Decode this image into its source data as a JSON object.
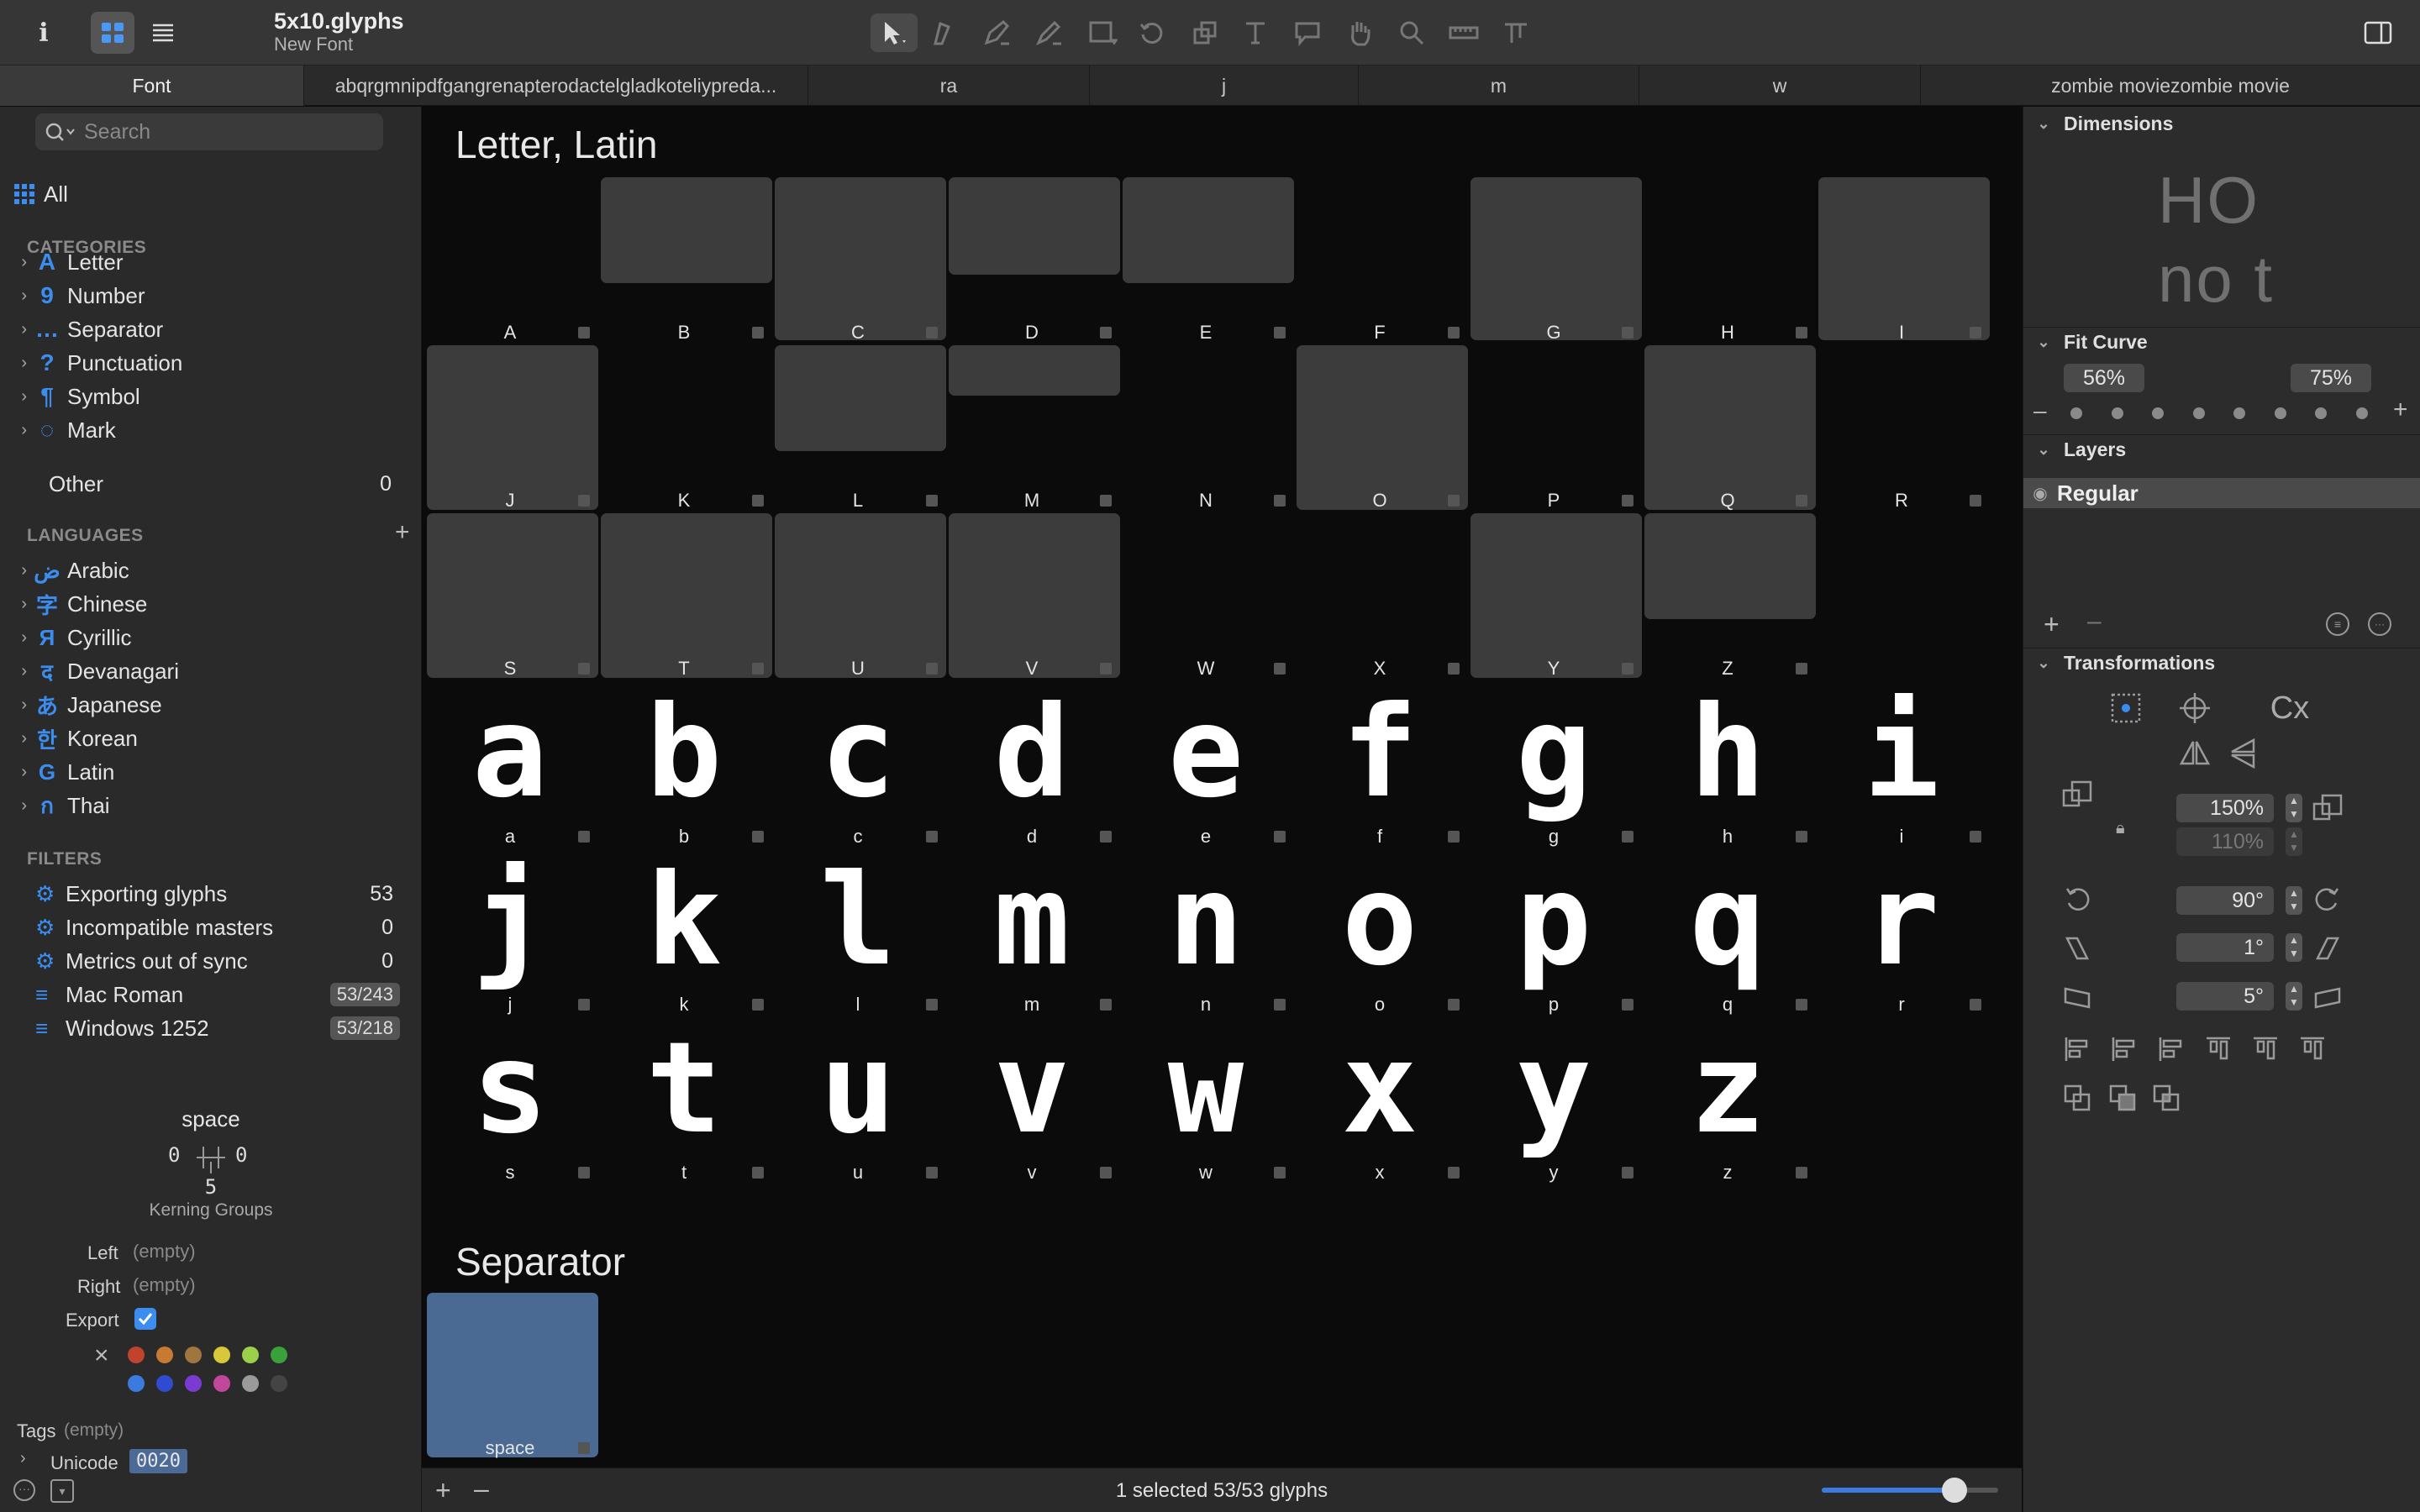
{
  "toolbar": {
    "info_glyph": "i",
    "title": "5x10.glyphs",
    "subtitle": "New Font",
    "tools": [
      "select-tool-icon",
      "draw-tool-icon",
      "pen-tool-icon",
      "pencil-tool-icon",
      "rectangle-tool-icon",
      "rotate-tool-icon",
      "scale-tool-icon",
      "text-tool-icon",
      "annotation-tool-icon",
      "hand-tool-icon",
      "zoom-tool-icon",
      "measure-tool-icon",
      "primitives-tool-icon"
    ]
  },
  "tabs": [
    {
      "label": "Font"
    },
    {
      "label": "abqrgmnipdfgangrenapterodactelgladkoteliypreda..."
    },
    {
      "label": "ra"
    },
    {
      "label": "j"
    },
    {
      "label": "m"
    },
    {
      "label": "w"
    },
    {
      "label": "zombie moviezombie movie"
    }
  ],
  "sidebar": {
    "search_placeholder": "Search",
    "all_label": "All",
    "categories_heading": "CATEGORIES",
    "categories": [
      {
        "icon": "A",
        "label": "Letter"
      },
      {
        "icon": "9",
        "label": "Number"
      },
      {
        "icon": "…",
        "label": "Separator"
      },
      {
        "icon": "?",
        "label": "Punctuation"
      },
      {
        "icon": "¶",
        "label": "Symbol"
      },
      {
        "icon": "◌",
        "label": "Mark"
      }
    ],
    "other": {
      "label": "Other",
      "count": "0"
    },
    "languages_heading": "LANGUAGES",
    "languages": [
      {
        "icon": "ض",
        "label": "Arabic"
      },
      {
        "icon": "字",
        "label": "Chinese"
      },
      {
        "icon": "Я",
        "label": "Cyrillic"
      },
      {
        "icon": "द",
        "label": "Devanagari"
      },
      {
        "icon": "あ",
        "label": "Japanese"
      },
      {
        "icon": "한",
        "label": "Korean"
      },
      {
        "icon": "G",
        "label": "Latin"
      },
      {
        "icon": "ก",
        "label": "Thai"
      }
    ],
    "filters_heading": "FILTERS",
    "filters": [
      {
        "label": "Exporting glyphs",
        "count": "53",
        "pill": false
      },
      {
        "label": "Incompatible masters",
        "count": "0",
        "pill": false
      },
      {
        "label": "Metrics out of sync",
        "count": "0",
        "pill": false
      },
      {
        "label": "Mac Roman",
        "count": "53/243",
        "pill": true
      },
      {
        "label": "Windows 1252",
        "count": "53/218",
        "pill": true
      }
    ]
  },
  "info": {
    "glyph_name": "space",
    "lsb": "0",
    "rsb": "0",
    "width": "5",
    "kerning_groups": "Kerning Groups",
    "left_label": "Left",
    "left_value": "(empty)",
    "right_label": "Right",
    "right_value": "(empty)",
    "export_label": "Export",
    "export_checked": true,
    "tags_label": "Tags",
    "tags_value": "(empty)",
    "unicode_label": "Unicode",
    "unicode_value": "0020",
    "colors": [
      "#c0432e",
      "#c97a32",
      "#a0763f",
      "#d6c83a",
      "#9ccf4a",
      "#3aa13a",
      "#3b7be0",
      "#2f4bd0",
      "#7c3bd0",
      "#c0479a",
      "#9a9a9a",
      "#444444"
    ]
  },
  "main": {
    "section_letter": "Letter, Latin",
    "section_separator": "Separator",
    "uppercase": [
      "A",
      "B",
      "C",
      "D",
      "E",
      "F",
      "G",
      "H",
      "I",
      "J",
      "K",
      "L",
      "M",
      "N",
      "O",
      "P",
      "Q",
      "R",
      "S",
      "T",
      "U",
      "V",
      "W",
      "X",
      "Y",
      "Z"
    ],
    "lowercase": [
      "a",
      "b",
      "c",
      "d",
      "e",
      "f",
      "g",
      "h",
      "i",
      "j",
      "k",
      "l",
      "m",
      "n",
      "o",
      "p",
      "q",
      "r",
      "s",
      "t",
      "u",
      "v",
      "w",
      "x",
      "y",
      "z"
    ],
    "separator_glyph": "space",
    "status": "1 selected 53/53 glyphs",
    "zoom_level": 0.75
  },
  "rpanel": {
    "dimensions_label": "Dimensions",
    "dim_top": "HO",
    "dim_bottom": "no t",
    "fitcurve_label": "Fit Curve",
    "fit_min": "56%",
    "fit_max": "75%",
    "layers_label": "Layers",
    "layer_name": "Regular",
    "transformations_label": "Transformations",
    "scale_x": "150%",
    "scale_y": "110%",
    "rotate": "90°",
    "slant": "1°",
    "skew": "5°"
  }
}
